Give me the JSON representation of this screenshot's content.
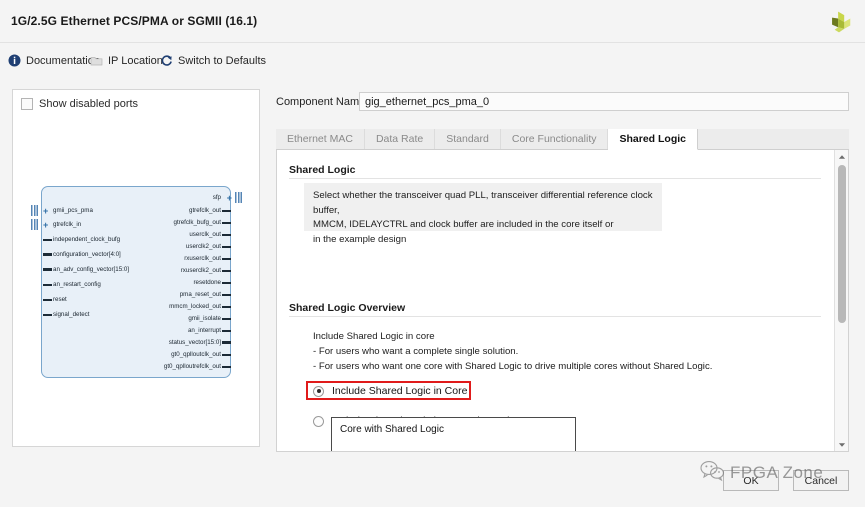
{
  "window": {
    "title": "1G/2.5G Ethernet PCS/PMA or SGMII (16.1)",
    "logo_icon": "xilinx-pinwheel-logo"
  },
  "toolbar": {
    "items": [
      {
        "label": "Documentation",
        "icon": "info-icon"
      },
      {
        "label": "IP Location",
        "icon": "folder-icon"
      },
      {
        "label": "Switch to Defaults",
        "icon": "refresh-icon"
      }
    ]
  },
  "left_panel": {
    "show_disabled_ports_label": "Show disabled ports",
    "show_disabled_ports_checked": false,
    "symbol": {
      "left_ports": [
        {
          "name": "gmii_pcs_pma",
          "kind": "bus-group"
        },
        {
          "name": "gtrefclk_in",
          "kind": "bus-group"
        },
        {
          "name": "independent_clock_bufg",
          "kind": "wire"
        },
        {
          "name": "configuration_vector[4:0]",
          "kind": "bus"
        },
        {
          "name": "an_adv_config_vector[15:0]",
          "kind": "bus"
        },
        {
          "name": "an_restart_config",
          "kind": "wire"
        },
        {
          "name": "reset",
          "kind": "wire"
        },
        {
          "name": "signal_detect",
          "kind": "wire"
        }
      ],
      "right_ports": [
        {
          "name": "sfp",
          "kind": "bus-group"
        },
        {
          "name": "gtrefclk_out",
          "kind": "wire"
        },
        {
          "name": "gtrefclk_bufg_out",
          "kind": "wire"
        },
        {
          "name": "userclk_out",
          "kind": "wire"
        },
        {
          "name": "userclk2_out",
          "kind": "wire"
        },
        {
          "name": "rxuserclk_out",
          "kind": "wire"
        },
        {
          "name": "rxuserclk2_out",
          "kind": "wire"
        },
        {
          "name": "resetdone",
          "kind": "wire"
        },
        {
          "name": "pma_reset_out",
          "kind": "wire"
        },
        {
          "name": "mmcm_locked_out",
          "kind": "wire"
        },
        {
          "name": "gmii_isolate",
          "kind": "wire"
        },
        {
          "name": "an_interrupt",
          "kind": "wire"
        },
        {
          "name": "status_vector[15:0]",
          "kind": "bus"
        },
        {
          "name": "gt0_qplloutclk_out",
          "kind": "wire"
        },
        {
          "name": "gt0_qplloutrefclk_out",
          "kind": "wire"
        }
      ]
    }
  },
  "component": {
    "label": "Component Name",
    "value": "gig_ethernet_pcs_pma_0",
    "placeholder": "Component Name"
  },
  "tabs": [
    {
      "label": "Ethernet MAC",
      "active": false
    },
    {
      "label": "Data Rate",
      "active": false
    },
    {
      "label": "Standard",
      "active": false
    },
    {
      "label": "Core Functionality",
      "active": false
    },
    {
      "label": "Shared Logic",
      "active": true
    }
  ],
  "shared_logic": {
    "section_title": "Shared Logic",
    "description_line1": "Select whether the transceiver quad PLL, transceiver differential reference clock buffer,",
    "description_line2": "MMCM, IDELAYCTRL and clock buffer are included in the core itself or",
    "description_line3": "in the example design",
    "options": [
      {
        "label": "Include Shared Logic in Core",
        "selected": true,
        "highlighted": true
      },
      {
        "label": "Include Shared Logic in Example Design",
        "selected": false,
        "highlighted": false
      }
    ]
  },
  "overview": {
    "section_title": "Shared Logic Overview",
    "lines": [
      "Include Shared Logic in core",
      "- For users who want a complete single solution.",
      "- For users who want one core with Shared Logic to drive multiple cores without Shared Logic."
    ],
    "diagram_title": "Core with Shared Logic"
  },
  "scrollbar": {
    "up_arrow_icon": "chevron-up-icon",
    "down_arrow_icon": "chevron-down-icon"
  },
  "footer": {
    "ok_label": "OK",
    "cancel_label": "Cancel"
  },
  "watermark": {
    "text": "FPGA Zone",
    "icon": "wechat-icon"
  },
  "colors": {
    "accent_blue": "#2f6ea5",
    "highlight_red": "#e01b1b",
    "symbol_fill": "#e8f0f8",
    "logo_green": "#8ec640",
    "logo_olive": "#6d7a1f"
  }
}
